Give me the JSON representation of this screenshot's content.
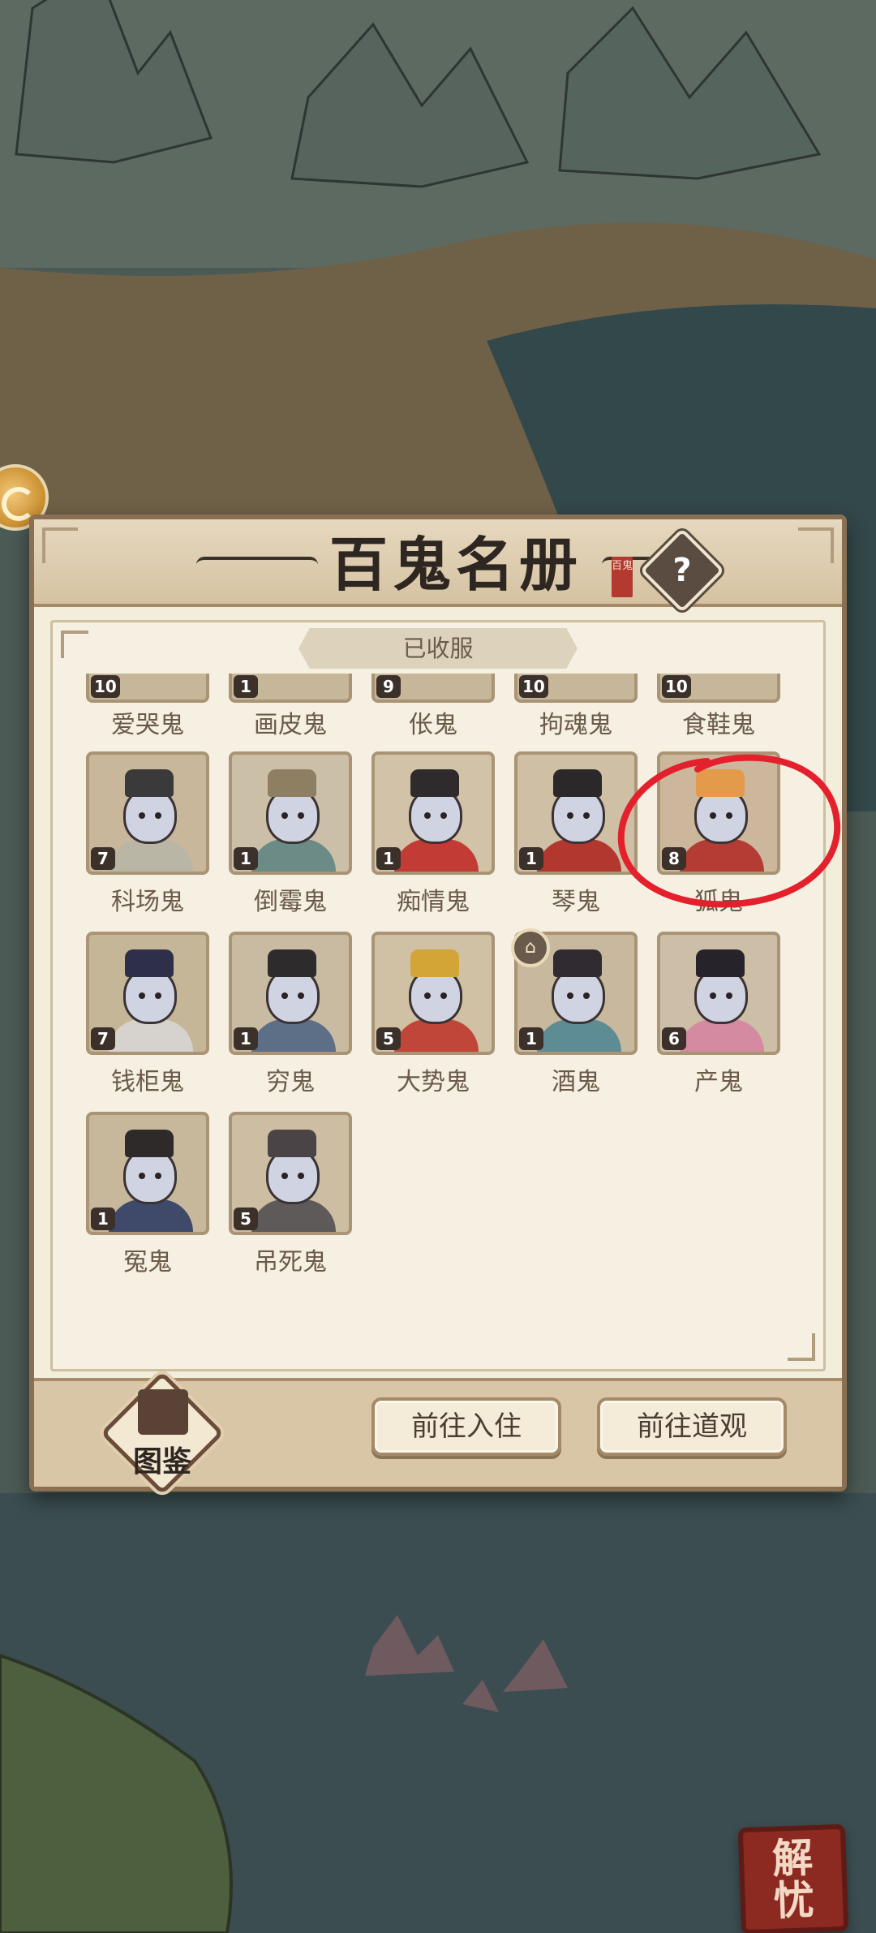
{
  "panel": {
    "title": "百鬼名册",
    "title_seal": "百鬼",
    "help": "?",
    "tab_label": "已收服"
  },
  "partial_row": [
    {
      "name": "爱哭鬼",
      "level": "10"
    },
    {
      "name": "画皮鬼",
      "level": "1"
    },
    {
      "name": "伥鬼",
      "level": "9"
    },
    {
      "name": "拘魂鬼",
      "level": "10"
    },
    {
      "name": "食鞋鬼",
      "level": "10"
    }
  ],
  "ghosts": [
    {
      "name": "科场鬼",
      "level": "7",
      "tone": "#c9b79b",
      "hat": "#3a3a3a",
      "body": "#b9b6a6"
    },
    {
      "name": "倒霉鬼",
      "level": "1",
      "tone": "#cbbfa8",
      "hat": "#8e7f63",
      "body": "#6c8a86"
    },
    {
      "name": "痴情鬼",
      "level": "1",
      "tone": "#d2c3a8",
      "hat": "#2f2a2b",
      "body": "#c23b35"
    },
    {
      "name": "琴鬼",
      "level": "1",
      "tone": "#cfbfa5",
      "hat": "#2c2729",
      "body": "#b2382f"
    },
    {
      "name": "狐鬼",
      "level": "8",
      "tone": "#cdb79c",
      "hat": "#e39a4a",
      "body": "#b43c34"
    },
    {
      "name": "钱柜鬼",
      "level": "7",
      "tone": "#c6b698",
      "hat": "#2d3048",
      "body": "#d6d3cf"
    },
    {
      "name": "穷鬼",
      "level": "1",
      "tone": "#c9bba1",
      "hat": "#2e2b2c",
      "body": "#5c6f86"
    },
    {
      "name": "大势鬼",
      "level": "5",
      "tone": "#d0c0a4",
      "hat": "#d2a536",
      "body": "#c0463a"
    },
    {
      "name": "酒鬼",
      "level": "1",
      "tone": "#c8b99e",
      "hat": "#2f2b30",
      "body": "#5d8c94"
    },
    {
      "name": "产鬼",
      "level": "6",
      "tone": "#cdbfa7",
      "hat": "#27232a",
      "body": "#d48aa0"
    },
    {
      "name": "冤鬼",
      "level": "1",
      "tone": "#c7b89c",
      "hat": "#2f2a2a",
      "body": "#3f4a6a"
    },
    {
      "name": "吊死鬼",
      "level": "5",
      "tone": "#ccbda3",
      "hat": "#4a4446",
      "body": "#5f5a5a"
    }
  ],
  "resident_icon": "pavilion-icon",
  "annotation_color": "#e3202c",
  "footer": {
    "codex_label": "图鉴",
    "move_in_label": "前往入住",
    "temple_label": "前往道观"
  },
  "seal_button": {
    "line1": "解",
    "line2": "忧"
  }
}
